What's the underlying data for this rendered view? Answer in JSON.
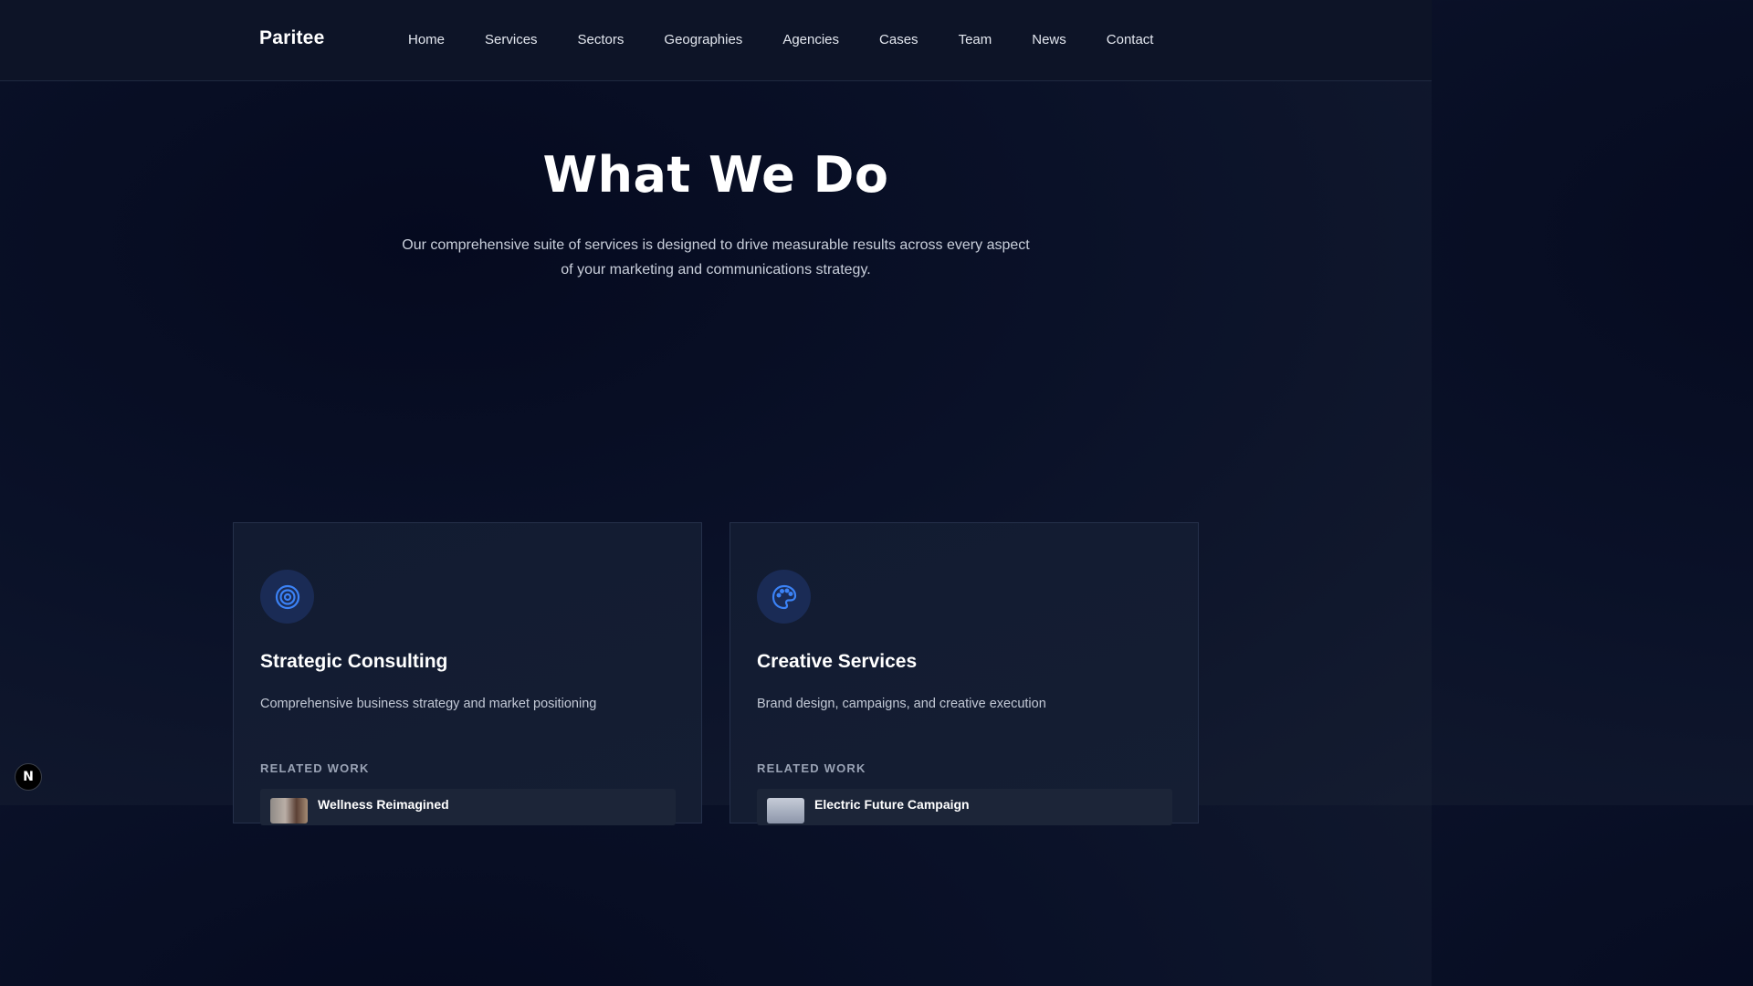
{
  "nav": {
    "logo": "Paritee",
    "links": [
      "Home",
      "Services",
      "Sectors",
      "Geographies",
      "Agencies",
      "Cases",
      "Team",
      "News",
      "Contact"
    ]
  },
  "hero": {
    "title": "What We Do",
    "subtitle_line1": "Our comprehensive suite of services is designed to drive measurable results across every aspect",
    "subtitle_line2": "of your marketing and communications strategy."
  },
  "cards": [
    {
      "icon": "target-icon",
      "title": "Strategic Consulting",
      "description": "Comprehensive business strategy and market positioning",
      "related_label": "RELATED WORK",
      "related_title": "Wellness Reimagined"
    },
    {
      "icon": "palette-icon",
      "title": "Creative Services",
      "description": "Brand design, campaigns, and creative execution",
      "related_label": "RELATED WORK",
      "related_title": "Electric Future Campaign"
    }
  ],
  "badge": {
    "letter": "N"
  },
  "colors": {
    "accent": "#3b82f6",
    "icon_bg": "#1a2b55",
    "background": "#0a1128"
  }
}
